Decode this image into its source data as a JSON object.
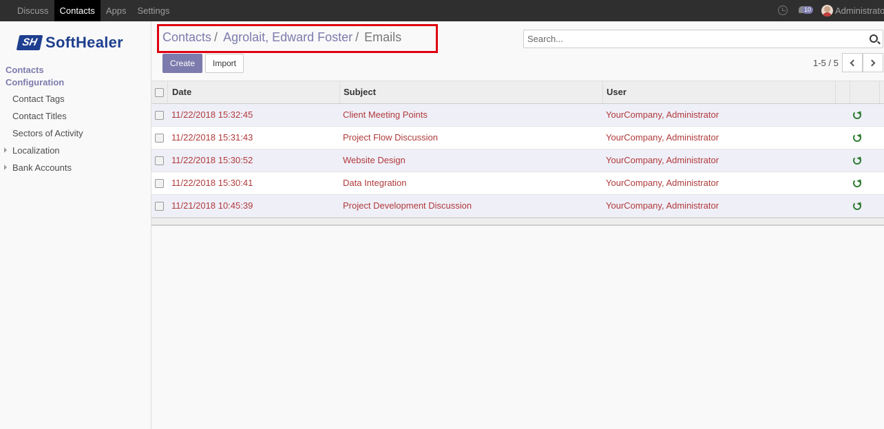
{
  "topbar": {
    "menu": [
      "Discuss",
      "Contacts",
      "Apps",
      "Settings"
    ],
    "active_menu": "Contacts",
    "message_count": "10",
    "user": "Administrator"
  },
  "sidebar": {
    "brand": "SoftHealer",
    "brand_mark": "SH",
    "head_contacts": "Contacts",
    "head_configuration": "Configuration",
    "items": [
      "Contact Tags",
      "Contact Titles",
      "Sectors of Activity",
      "Localization",
      "Bank Accounts"
    ]
  },
  "breadcrumb": {
    "items": [
      "Contacts",
      "Agrolait, Edward Foster",
      "Emails"
    ],
    "separator": "/"
  },
  "search": {
    "placeholder": "Search..."
  },
  "buttons": {
    "create": "Create",
    "import": "Import"
  },
  "pager": {
    "value": "1-5 / 5"
  },
  "table": {
    "headers": {
      "date": "Date",
      "subject": "Subject",
      "user": "User"
    },
    "rows": [
      {
        "date": "11/22/2018 15:32:45",
        "subject": "Client Meeting Points",
        "user": "YourCompany, Administrator"
      },
      {
        "date": "11/22/2018 15:31:43",
        "subject": "Project Flow Discussion",
        "user": "YourCompany, Administrator"
      },
      {
        "date": "11/22/2018 15:30:52",
        "subject": "Website Design",
        "user": "YourCompany, Administrator"
      },
      {
        "date": "11/22/2018 15:30:41",
        "subject": "Data Integration",
        "user": "YourCompany, Administrator"
      },
      {
        "date": "11/21/2018 10:45:39",
        "subject": "Project Development Discussion",
        "user": "YourCompany, Administrator"
      }
    ]
  },
  "colors": {
    "accent": "#7c7bad",
    "row_text": "#b03a3a",
    "highlight": "#e0000f",
    "refresh": "#2e7d32"
  }
}
